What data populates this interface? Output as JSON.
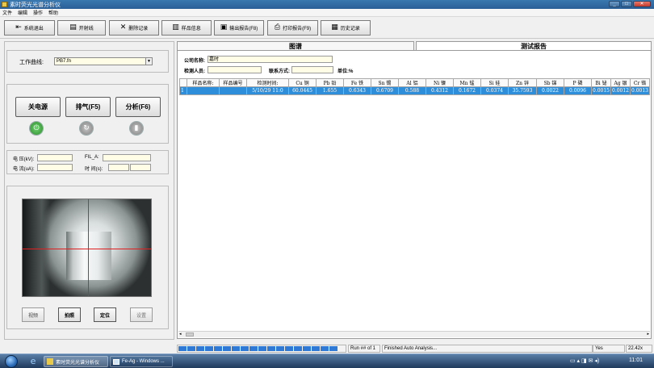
{
  "window": {
    "title": "素时荧光光谱分析仪",
    "controls": [
      "_",
      "□",
      "✕"
    ]
  },
  "menu": [
    "文件",
    "编辑",
    "操作",
    "帮助"
  ],
  "toolbar": {
    "buttons": [
      {
        "label": "系统退出",
        "icon": "exit-icon"
      },
      {
        "label": "开射线",
        "icon": "xray-icon"
      },
      {
        "label": "删除记录",
        "icon": "delete-icon"
      },
      {
        "label": "样品信息",
        "icon": "sample-icon"
      },
      {
        "label": "输出报告(F8)",
        "icon": "export-icon"
      },
      {
        "label": "打印报告(F9)",
        "icon": "print-icon"
      },
      {
        "label": "历史记录",
        "icon": "history-icon"
      }
    ]
  },
  "left": {
    "curve_label": "工作曲线:",
    "curve_value": "PB7.fn",
    "buttons": {
      "power": "关电源",
      "exhaust": "排气(F5)",
      "analyze": "分析(F6)"
    },
    "fields": {
      "voltage_label": "电 压(kV):",
      "current_label": "电 流(uA):",
      "fil_label": "FIL_A:",
      "time_label": "时 间(s):"
    },
    "camera_buttons": {
      "video": "视频",
      "photo": "拍照",
      "locate": "定位",
      "settings": "设置"
    }
  },
  "tabs": {
    "spectrum": "图谱",
    "report": "测试报告"
  },
  "report": {
    "company_label": "公司名称:",
    "company_value": "嘉时",
    "inspector_label": "检测人员:",
    "contact_label": "联系方式:",
    "unit_label": "单位:%",
    "columns": [
      "样品名称:",
      "样品编号",
      "检测时间:",
      "Cu 铜",
      "Pb 铅",
      "Fe 铁",
      "Sn 锡",
      "Al 铝",
      "Ni 镍",
      "Mn 锰",
      "Si 硅",
      "Zn 锌",
      "Sb 锑",
      "P 磷",
      "Bi 铋",
      "Ag 银",
      "Cr 铬"
    ],
    "rows": [
      {
        "index": "1",
        "cells": [
          "",
          "",
          "5/10/29 11:0",
          "60.0445",
          "1.655",
          "0.6343",
          "0.6709",
          "0.588",
          "0.4312",
          "0.1672",
          "0.0374",
          "35.7593",
          "0.0022",
          "0.0096",
          "0.0015",
          "0.0012",
          "0.0013"
        ]
      }
    ]
  },
  "status": {
    "run": "Run ## of 1",
    "message": "Finished Auto Analysis...",
    "yes": "Yes",
    "zoom": "22.42x"
  },
  "taskbar": {
    "items": [
      "素时荧光光谱分析仪",
      "Fe-Ag - Windows ..."
    ],
    "clock": "11:01"
  },
  "colors": {
    "title_bar": "#2f669e",
    "selected_row": "#2f8ed9",
    "input_bg": "#fffde6",
    "power_icon": "#3aa83a",
    "progress": "#2e79d6"
  },
  "progress_blocks": 18
}
